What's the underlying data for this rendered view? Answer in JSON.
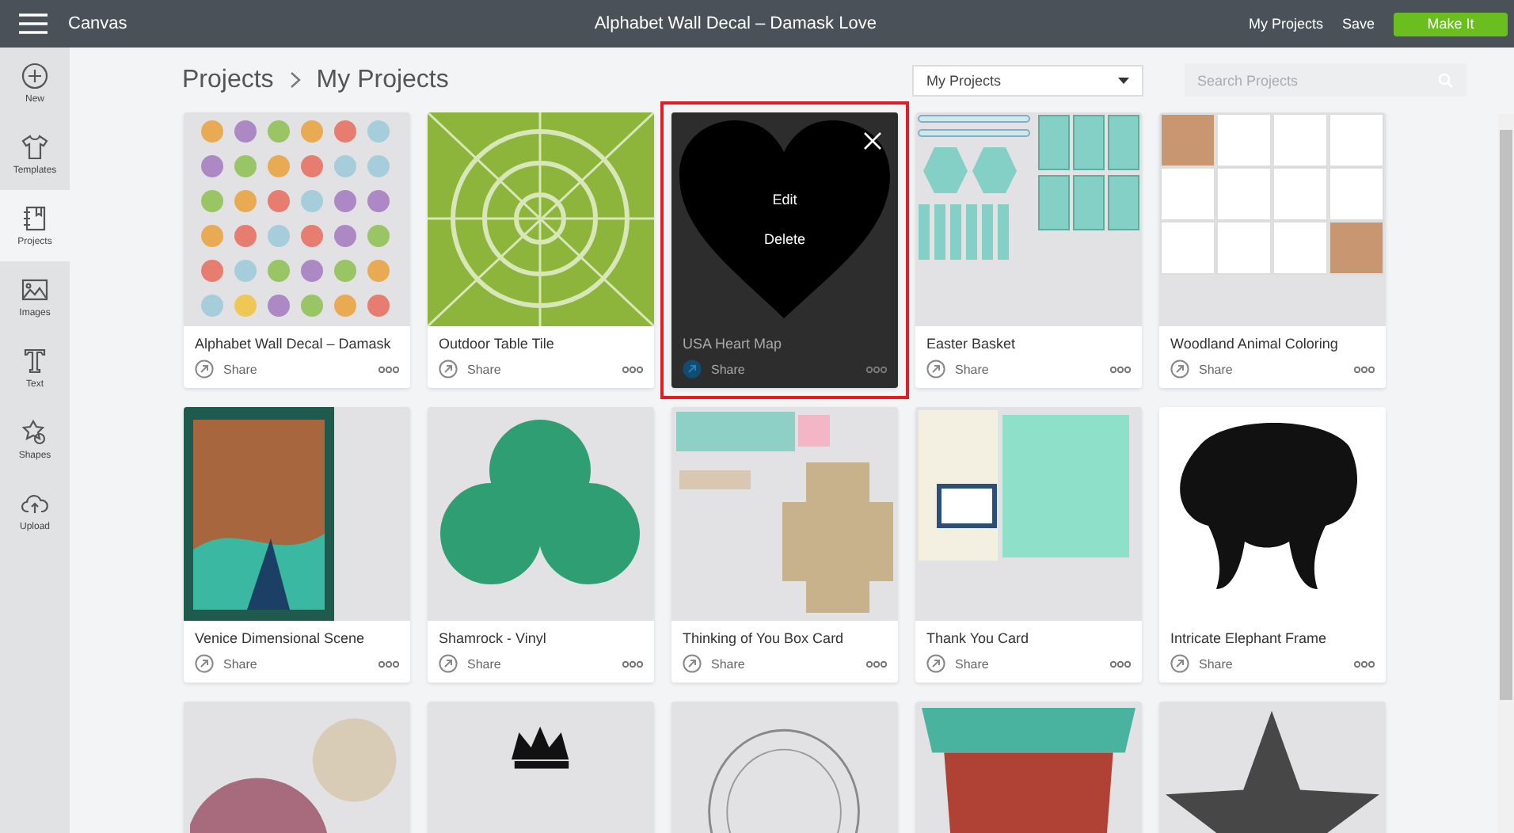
{
  "topbar": {
    "app_name": "Canvas",
    "title": "Alphabet Wall Decal – Damask Love",
    "links": [
      "My Projects",
      "Save"
    ],
    "make_button": "Make It"
  },
  "sidebar": {
    "items": [
      {
        "kind": "new",
        "label": "New",
        "selected": false
      },
      {
        "kind": "templates",
        "label": "Templates",
        "selected": false
      },
      {
        "kind": "projects",
        "label": "Projects",
        "selected": true
      },
      {
        "kind": "images",
        "label": "Images",
        "selected": false
      },
      {
        "kind": "text",
        "label": "Text",
        "selected": false
      },
      {
        "kind": "shapes",
        "label": "Shapes",
        "selected": false
      },
      {
        "kind": "upload",
        "label": "Upload",
        "selected": false
      }
    ]
  },
  "breadcrumb": [
    "Projects",
    "My Projects"
  ],
  "filter_dropdown": {
    "value": "My Projects"
  },
  "search": {
    "placeholder": "Search Projects"
  },
  "overlay_actions": [
    "Edit",
    "Delete"
  ],
  "cards": [
    {
      "kind": "alphabet",
      "title": "Alphabet Wall Decal – Damask",
      "share": "Share",
      "highlighted": false
    },
    {
      "kind": "tile",
      "title": "Outdoor Table Tile",
      "share": "Share",
      "highlighted": false
    },
    {
      "kind": "heart",
      "title": "USA Heart Map",
      "share": "Share",
      "highlighted": true
    },
    {
      "kind": "basket",
      "title": "Easter Basket",
      "share": "Share",
      "highlighted": false
    },
    {
      "kind": "woodland",
      "title": "Woodland Animal Coloring",
      "share": "Share",
      "highlighted": false
    },
    {
      "kind": "venice",
      "title": "Venice Dimensional Scene",
      "share": "Share",
      "highlighted": false
    },
    {
      "kind": "shamrock",
      "title": "Shamrock - Vinyl",
      "share": "Share",
      "highlighted": false
    },
    {
      "kind": "boxcard",
      "title": "Thinking of You Box Card",
      "share": "Share",
      "highlighted": false
    },
    {
      "kind": "thankyou",
      "title": "Thank You Card",
      "share": "Share",
      "highlighted": false
    },
    {
      "kind": "elephant",
      "title": "Intricate Elephant Frame",
      "share": "Share",
      "highlighted": false
    },
    {
      "kind": "circles"
    },
    {
      "kind": "crown"
    },
    {
      "kind": "lace"
    },
    {
      "kind": "pot"
    },
    {
      "kind": "star"
    }
  ]
}
